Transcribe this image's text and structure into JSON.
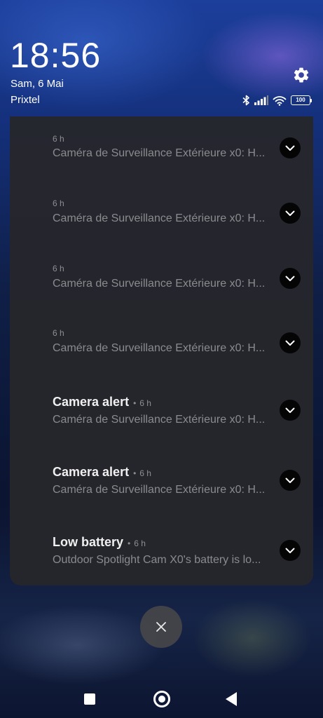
{
  "status": {
    "time": "18:56",
    "date": "Sam, 6 Mai",
    "carrier": "Prixtel",
    "battery": "100"
  },
  "notifications": [
    {
      "title": "",
      "time": "6 h",
      "body": "Caméra de Surveillance Extérieure x0: H..."
    },
    {
      "title": "",
      "time": "6 h",
      "body": "Caméra de Surveillance Extérieure x0: H..."
    },
    {
      "title": "",
      "time": "6 h",
      "body": "Caméra de Surveillance Extérieure x0: H..."
    },
    {
      "title": "",
      "time": "6 h",
      "body": "Caméra de Surveillance Extérieure x0: H..."
    },
    {
      "title": "Camera alert",
      "time": "6 h",
      "body": "Caméra de Surveillance Extérieure x0: H..."
    },
    {
      "title": "Camera alert",
      "time": "6 h",
      "body": "Caméra de Surveillance Extérieure x0: H..."
    },
    {
      "title": "Low battery",
      "time": "6 h",
      "body": "Outdoor Spotlight Cam X0's battery is lo..."
    }
  ],
  "icons": {
    "settings": "gear-icon",
    "bluetooth": "bluetooth-icon",
    "signal": "signal-icon",
    "wifi": "wifi-icon",
    "expand": "chevron-down-icon",
    "clear": "close-icon"
  }
}
